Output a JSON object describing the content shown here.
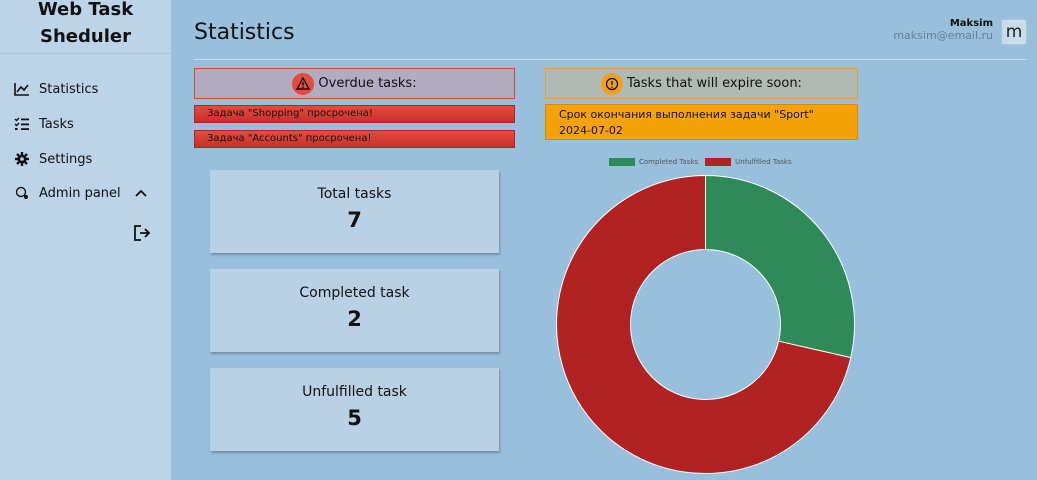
{
  "app": {
    "title_line1": "Web Task",
    "title_line2": "Sheduler"
  },
  "sidebar": {
    "items": [
      {
        "label": "Statistics",
        "icon": "chart-line-icon"
      },
      {
        "label": "Tasks",
        "icon": "list-check-icon"
      },
      {
        "label": "Settings",
        "icon": "gear-icon"
      },
      {
        "label": "Admin panel",
        "icon": "admin-shield-icon",
        "chevron": "chevron-up-icon"
      }
    ],
    "logout_icon": "logout-icon"
  },
  "header": {
    "title": "Statistics",
    "user_name": "Maksim",
    "user_email": "maksim@email.ru",
    "avatar_letter": "m"
  },
  "overdue": {
    "title": "Overdue tasks:",
    "icon": "warning-icon",
    "items": [
      "Задача \"Shopping\" просрочена!",
      "Задача \"Accounts\" просрочена!"
    ]
  },
  "expiring": {
    "title": "Tasks that will expire soon:",
    "icon": "info-icon",
    "items": [
      "Срок окончания выполнения задачи \"Sport\" 2024-07-02"
    ]
  },
  "stats": [
    {
      "label": "Total tasks",
      "value": "7"
    },
    {
      "label": "Completed task",
      "value": "2"
    },
    {
      "label": "Unfulfilled task",
      "value": "5"
    }
  ],
  "colors": {
    "completed": "#2e8b57",
    "unfulfilled": "#b22222",
    "overdue_accent": "#e64a3b",
    "expiring_accent": "#f5a208"
  },
  "chart_data": {
    "type": "pie",
    "categories": [
      "Completed Tasks",
      "Unfulfilled Tasks"
    ],
    "values": [
      2,
      5
    ],
    "colors": [
      "#2e8b57",
      "#b22222"
    ],
    "donut": true,
    "legend": "top"
  }
}
